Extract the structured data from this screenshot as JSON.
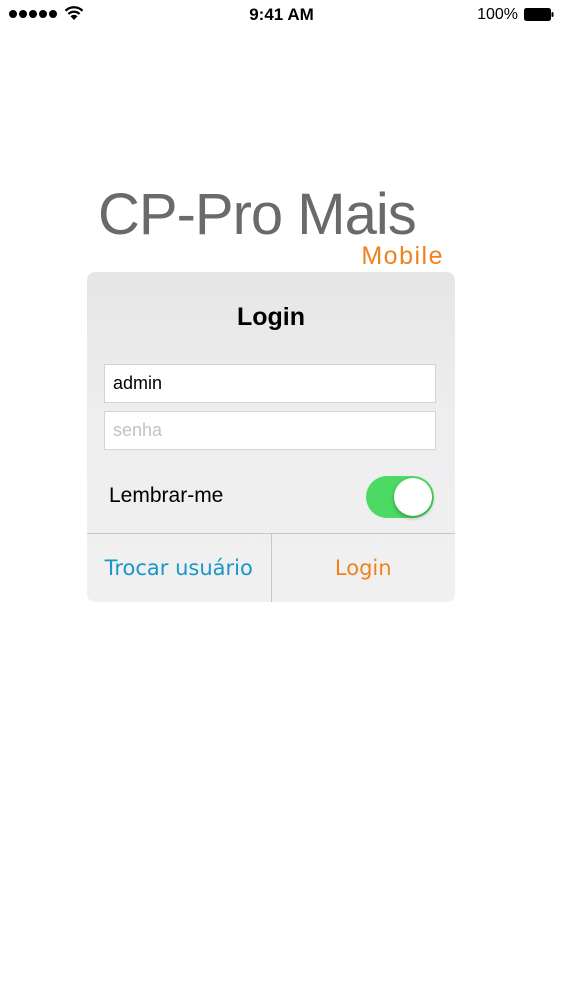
{
  "status_bar": {
    "time": "9:41 AM",
    "battery_percent": "100%"
  },
  "logo": {
    "main": "CP-Pro Mais",
    "sub": "Mobile"
  },
  "dialog": {
    "title": "Login",
    "username_value": "admin",
    "password_placeholder": "senha",
    "remember_label": "Lembrar-me",
    "remember_enabled": true,
    "switch_user_label": "Trocar usuário",
    "login_label": "Login"
  },
  "colors": {
    "accent_orange": "#f0821e",
    "link_blue": "#1a97c8",
    "toggle_on": "#4cd964",
    "logo_gray": "#6a6a6a"
  },
  "icons": [
    "signal-strength-icon",
    "wifi-icon",
    "battery-icon"
  ]
}
